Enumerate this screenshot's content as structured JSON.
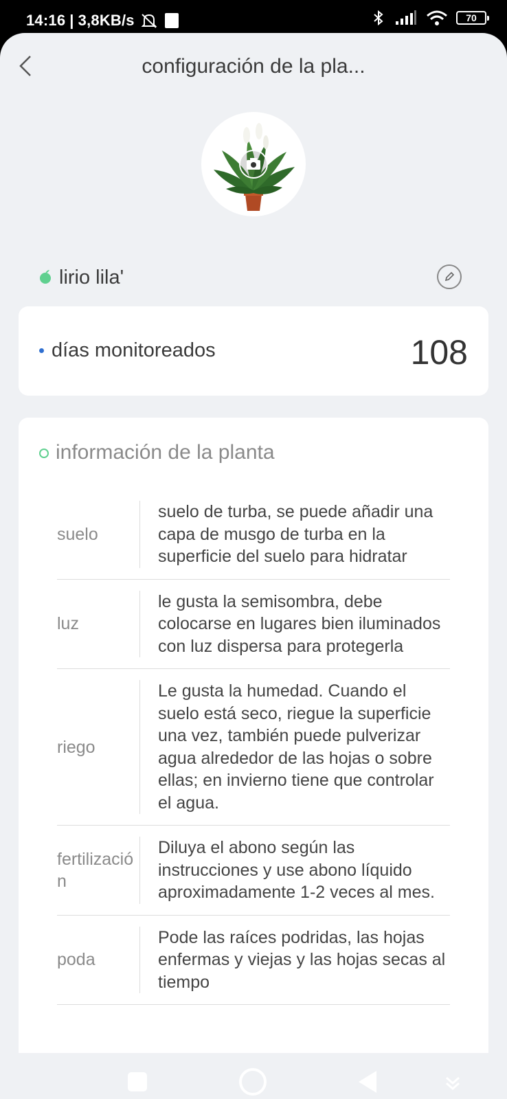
{
  "status_bar": {
    "time": "14:16",
    "separator": "|",
    "network_speed": "3,8KB/s",
    "battery": "70",
    "icons": [
      "notifications-muted-icon",
      "notification-icon",
      "bluetooth-icon",
      "signal-icon",
      "wifi-icon",
      "battery-icon"
    ]
  },
  "header": {
    "title": "configuración de la pla...",
    "back_icon": "chevron-left-icon"
  },
  "plant": {
    "photo_icon": "camera-icon",
    "name": "lirio lila'",
    "edit_icon": "pencil-icon"
  },
  "stats": {
    "days_label": "días monitoreados",
    "days_value": "108"
  },
  "info": {
    "title": "información de la planta",
    "rows": [
      {
        "key": "suelo",
        "value": "suelo de turba, se puede añadir una capa de musgo de turba en la superficie del suelo para hidratar"
      },
      {
        "key": "luz",
        "value": "le gusta la semisombra, debe colocarse en lugares bien iluminados con luz dispersa para protegerla"
      },
      {
        "key": "riego",
        "value": "Le gusta la humedad. Cuando el suelo está seco, riegue la superficie una vez, también puede pulverizar agua alrededor de las hojas o sobre ellas; en invierno tiene que controlar el agua."
      },
      {
        "key": "fertilización",
        "value": "Diluya el abono según las instrucciones y use abono líquido aproximadamente 1-2 veces al mes."
      },
      {
        "key": "poda",
        "value": "Pode las raíces podridas, las hojas enfermas y viejas y las hojas secas al tiempo"
      }
    ]
  },
  "colors": {
    "accent_green": "#5fd08f",
    "accent_blue": "#2f6fd0",
    "background": "#eff1f4"
  },
  "nav": {
    "icons": [
      "recent-apps-icon",
      "home-icon",
      "back-icon",
      "hide-nav-icon"
    ]
  }
}
